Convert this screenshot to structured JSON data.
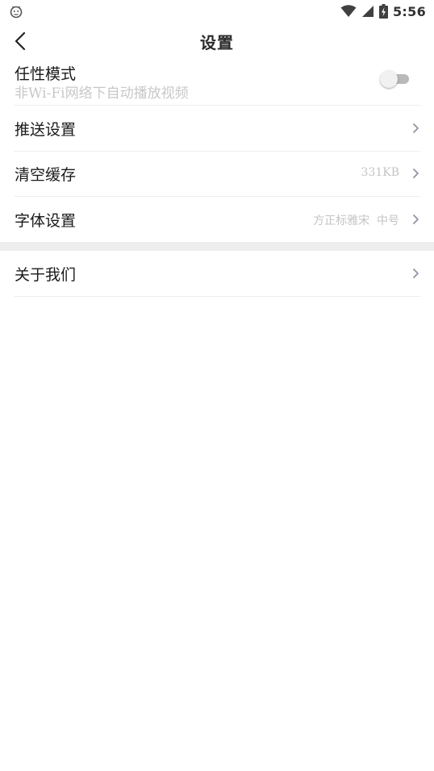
{
  "status_bar": {
    "time": "5:56",
    "left_icon": "android-debug-icon",
    "icons": [
      "wifi-icon",
      "cell-signal-icon",
      "battery-charging-icon"
    ]
  },
  "header": {
    "title": "设置",
    "back_icon": "back-arrow-icon"
  },
  "settings": {
    "wayward_mode": {
      "title": "任性模式",
      "subtitle": "非Wi-Fi网络下自动播放视频",
      "toggle_on": false
    },
    "push": {
      "title": "推送设置"
    },
    "cache": {
      "title": "清空缓存",
      "value": "331KB"
    },
    "font": {
      "title": "字体设置",
      "value": "方正标雅宋  中号"
    },
    "about": {
      "title": "关于我们"
    }
  },
  "colors": {
    "background": "#ffffff",
    "divider": "#efefef",
    "section_gap": "#eeeeee",
    "secondary_text": "#c4c4c4",
    "chevron": "#8e94a6"
  }
}
